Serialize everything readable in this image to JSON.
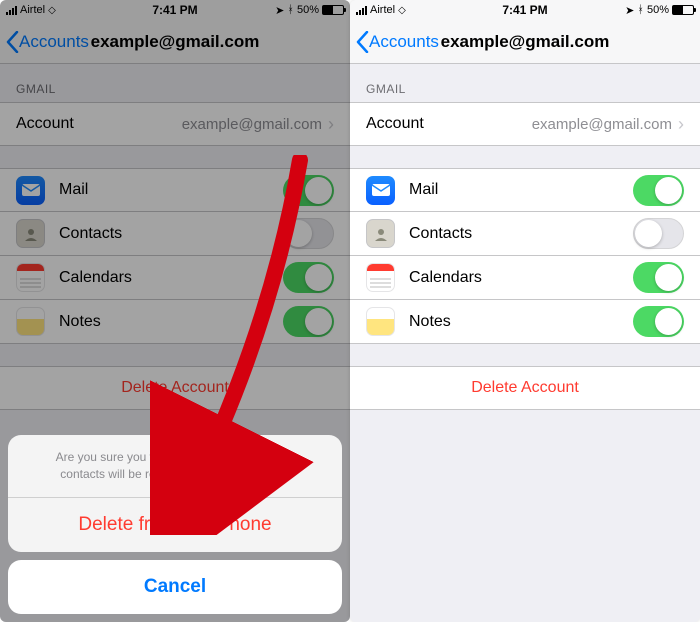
{
  "statusbar": {
    "carrier": "Airtel",
    "time": "7:41 PM",
    "battery_pct": "50%",
    "battery_fill": 50
  },
  "nav": {
    "back_label": "Accounts",
    "title": "example@gmail.com"
  },
  "section_header": "GMAIL",
  "account_row": {
    "label": "Account",
    "value": "example@gmail.com"
  },
  "services": [
    {
      "key": "mail",
      "label": "Mail",
      "on": true
    },
    {
      "key": "contacts",
      "label": "Contacts",
      "on": false
    },
    {
      "key": "calendars",
      "label": "Calendars",
      "on": true
    },
    {
      "key": "notes",
      "label": "Notes",
      "on": true
    }
  ],
  "delete_label": "Delete Account",
  "sheet": {
    "message": "Are you sure you want to continue? All Gmail contacts will be removed from your iPhone.",
    "destructive": "Delete from My iPhone",
    "cancel": "Cancel"
  }
}
